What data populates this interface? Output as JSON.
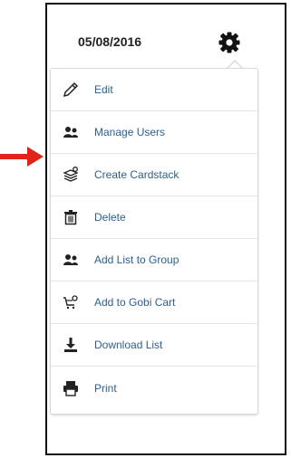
{
  "header": {
    "date": "05/08/2016",
    "settings_icon": "gear-icon"
  },
  "menu": {
    "items": [
      {
        "label": "Edit",
        "icon": "pencil-icon"
      },
      {
        "label": "Manage Users",
        "icon": "users-icon"
      },
      {
        "label": "Create Cardstack",
        "icon": "cardstack-icon"
      },
      {
        "label": "Delete",
        "icon": "trash-icon"
      },
      {
        "label": "Add List to Group",
        "icon": "users-icon"
      },
      {
        "label": "Add to Gobi Cart",
        "icon": "cart-icon"
      },
      {
        "label": "Download List",
        "icon": "download-icon"
      },
      {
        "label": "Print",
        "icon": "print-icon"
      }
    ]
  },
  "colors": {
    "link": "#2c5f94",
    "annotation_arrow": "#e2231a"
  }
}
